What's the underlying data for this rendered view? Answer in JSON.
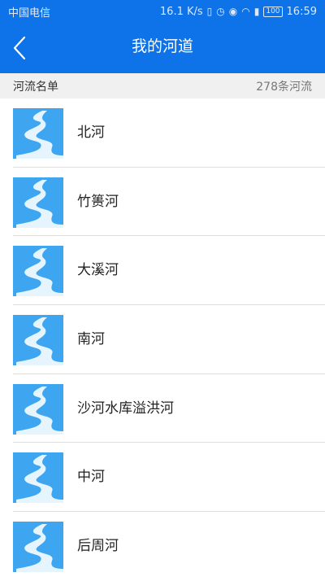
{
  "status_bar": {
    "carrier": "中国电信",
    "speed": "16.1 K/s",
    "battery": "100",
    "time": "16:59"
  },
  "header": {
    "title": "我的河道"
  },
  "list_header": {
    "label": "河流名单",
    "count": "278条河流"
  },
  "rivers": [
    {
      "name": "北河"
    },
    {
      "name": "竹篑河"
    },
    {
      "name": "大溪河"
    },
    {
      "name": "南河"
    },
    {
      "name": "沙河水库溢洪河"
    },
    {
      "name": "中河"
    },
    {
      "name": "后周河"
    }
  ],
  "colors": {
    "primary": "#0e72e8",
    "thumb_bg": "#3ea6f0",
    "river": "#e6f4fe"
  },
  "icons": {
    "back": "back-arrow-icon",
    "river": "river-icon"
  }
}
